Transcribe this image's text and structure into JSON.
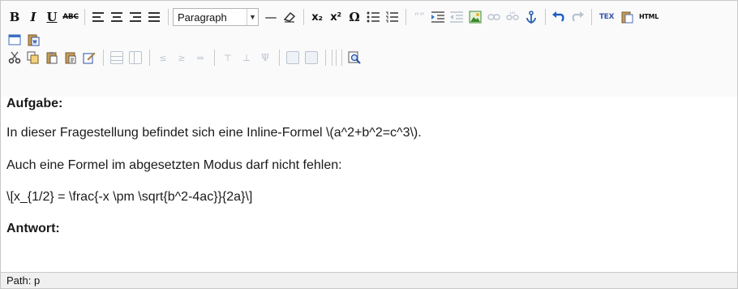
{
  "toolbar": {
    "row1": {
      "bold": "B",
      "italic": "I",
      "underline": "U",
      "strikethrough": "ABC",
      "format_select": "Paragraph",
      "hr": "—",
      "subscript": "x₂",
      "superscript": "x²",
      "special_char": "Ω",
      "blockquote": "“”",
      "tex": "TEX",
      "html": "HTML"
    }
  },
  "content": {
    "heading1": "Aufgabe:",
    "line1": "In dieser Fragestellung befindet sich eine Inline-Formel \\(a^2+b^2=c^3\\).",
    "line2": "Auch eine Formel im abgesetzten Modus darf nicht fehlen:",
    "line3": "\\[x_{1/2} = \\frac{-x \\pm \\sqrt{b^2-4ac}}{2a}\\]",
    "heading2": "Antwort:"
  },
  "statusbar": {
    "path": "Path: p"
  },
  "colors": {
    "disabled_icon": "#b9c3cf",
    "undo_icon": "#1f5fbf",
    "anchor_icon": "#2a62b0",
    "image_icon": "#3b8a2f"
  }
}
